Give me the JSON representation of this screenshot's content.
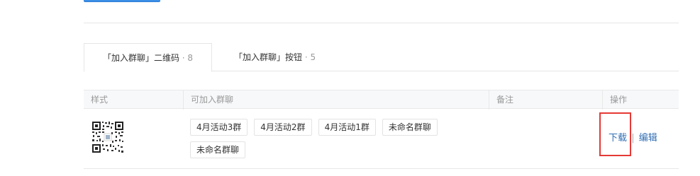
{
  "tabs": [
    {
      "label": "「加入群聊」二维码",
      "count": "· 8"
    },
    {
      "label": "「加入群聊」按钮",
      "count": "· 5"
    }
  ],
  "table": {
    "headers": [
      "样式",
      "可加入群聊",
      "备注",
      "操作"
    ],
    "row": {
      "groups": [
        "4月活动3群",
        "4月活动2群",
        "4月活动1群",
        "未命名群聊",
        "未命名群聊"
      ],
      "note": "",
      "actions": {
        "download": "下载",
        "separator": "|",
        "edit": "编辑"
      }
    }
  },
  "colors": {
    "link": "#2f6db3",
    "highlight": "#e53935",
    "header_bg": "#f7f8fa"
  }
}
